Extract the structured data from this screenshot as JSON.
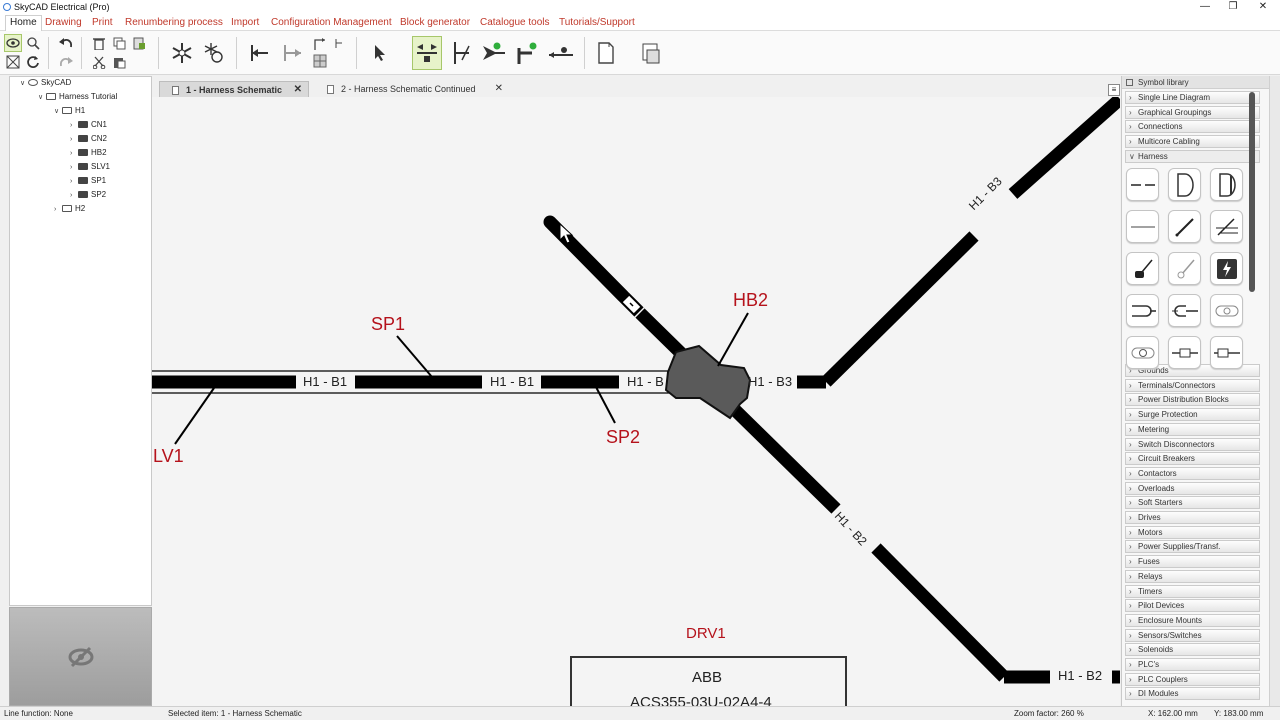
{
  "window": {
    "title": "SkyCAD Electrical (Pro)",
    "minimize": "—",
    "restore": "❐",
    "close": "✕"
  },
  "menu": [
    "Home",
    "Drawing",
    "Print",
    "Renumbering process",
    "Import",
    "Configuration Management",
    "Block generator",
    "Catalogue tools",
    "Tutorials/Support"
  ],
  "toolbar": {
    "icons": [
      "eye-icon",
      "zoom-icon",
      "undo-icon",
      "delete-icon",
      "copy-icon",
      "paste-format-icon",
      "zoom-extents-icon",
      "refresh-icon",
      "redo-icon",
      "cut-icon",
      "paste-icon",
      "snowflake-icon",
      "snowflake-refresh-icon",
      "connect-left-icon",
      "connect-right-icon",
      "route-icon",
      "grid-icon",
      "pointer-icon",
      "move-wire-icon",
      "terminal-icon",
      "arrow-star-icon",
      "branch-star-icon",
      "dot-line-icon",
      "document-icon",
      "save-icon"
    ]
  },
  "tree": {
    "nodes": [
      {
        "label": "SkyCAD",
        "depth": 0,
        "expanded": true
      },
      {
        "label": "Harness Tutorial",
        "depth": 1,
        "expanded": true
      },
      {
        "label": "H1",
        "depth": 2,
        "expanded": true
      },
      {
        "label": "CN1",
        "depth": 3,
        "expanded": false
      },
      {
        "label": "CN2",
        "depth": 3,
        "expanded": false
      },
      {
        "label": "HB2",
        "depth": 3,
        "expanded": false
      },
      {
        "label": "SLV1",
        "depth": 3,
        "expanded": false
      },
      {
        "label": "SP1",
        "depth": 3,
        "expanded": false
      },
      {
        "label": "SP2",
        "depth": 3,
        "expanded": false
      },
      {
        "label": "H2",
        "depth": 2,
        "expanded": false
      }
    ]
  },
  "tabs": [
    {
      "label": "1 - Harness Schematic",
      "active": true,
      "close": "✕"
    },
    {
      "label": "2 - Harness Schematic Continued",
      "active": false,
      "close": "✕"
    }
  ],
  "canvas": {
    "labels_red": [
      "SP1",
      "HB2",
      "LV1",
      "SP2",
      "DRV1"
    ],
    "segments": [
      "H1 - B1",
      "H1 - B1",
      "H1 - B",
      "H1 - B3",
      "H1 - B3",
      "H1 - B2",
      "H1 - B2"
    ],
    "device": {
      "maker": "ABB",
      "model": "ACS355-03U-02A4-4"
    },
    "menu_glyph": "≡",
    "colors": {
      "label_red": "#b5121b",
      "wire": "#000000",
      "hub": "#5a5a5a",
      "background": "#f4f4f4"
    }
  },
  "library": {
    "title": "Symbol library",
    "categories_top": [
      "Single Line Diagram",
      "Graphical Groupings",
      "Connections",
      "Multicore Cabling"
    ],
    "open_category": "Harness",
    "symbols": [
      "wire-dashed-icon",
      "connector-d-icon",
      "connector-d-dark-icon",
      "wire-plain-icon",
      "wire-slash-icon",
      "wire-slash-break-icon",
      "splice-icon",
      "splice-light-icon",
      "lightning-icon",
      "sleeve-open-icon",
      "sleeve-closed-icon",
      "grommet-icon",
      "grommet-round-icon",
      "clip-icon",
      "clip-end-icon"
    ],
    "categories_bottom": [
      "Grounds",
      "Terminals/Connectors",
      "Power Distribution Blocks",
      "Surge Protection",
      "Metering",
      "Switch Disconnectors",
      "Circuit Breakers",
      "Contactors",
      "Overloads",
      "Soft Starters",
      "Drives",
      "Motors",
      "Power Supplies/Transf.",
      "Fuses",
      "Relays",
      "Timers",
      "Pilot Devices",
      "Enclosure Mounts",
      "Sensors/Switches",
      "Solenoids",
      "PLC's",
      "PLC Couplers",
      "DI Modules"
    ]
  },
  "status": {
    "line_function": "Line function: None",
    "selected": "Selected item: 1 - Harness Schematic",
    "zoom": "Zoom factor: 260 %",
    "x": "X: 162.00 mm",
    "y": "Y: 183.00 mm"
  }
}
